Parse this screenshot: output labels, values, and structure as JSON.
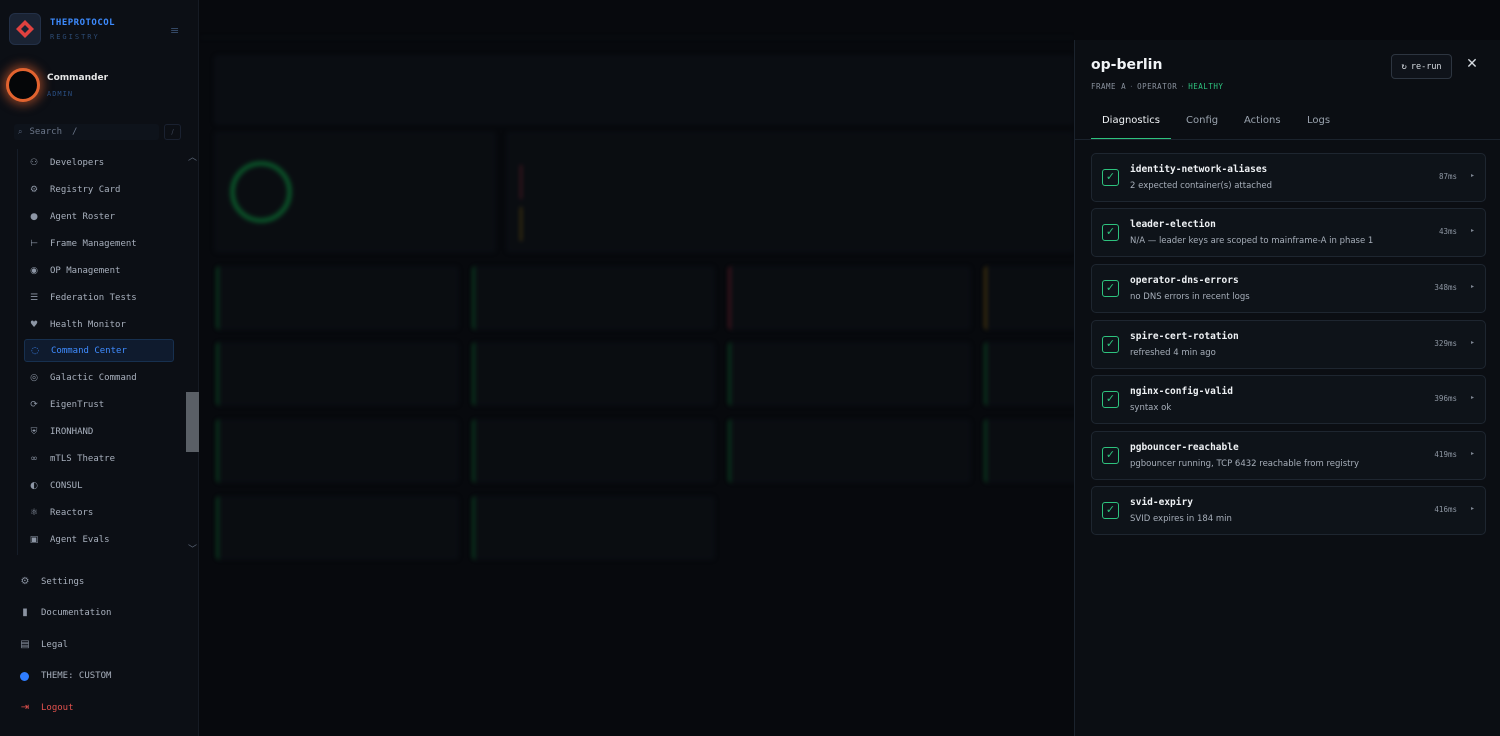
{
  "brand": {
    "name": "THEPROTOCOL",
    "subtitle": "REGISTRY"
  },
  "user": {
    "name": "Commander",
    "role": "ADMIN"
  },
  "search": {
    "label": "Search",
    "shortcut": "/"
  },
  "nav": {
    "items": [
      {
        "label": "Developers",
        "icon": "users-icon"
      },
      {
        "label": "Registry Card",
        "icon": "card-icon"
      },
      {
        "label": "Agent Roster",
        "icon": "person-icon"
      },
      {
        "label": "Frame Management",
        "icon": "frame-icon"
      },
      {
        "label": "OP Management",
        "icon": "op-icon"
      },
      {
        "label": "Federation Tests",
        "icon": "server-icon"
      },
      {
        "label": "Health Monitor",
        "icon": "heart-pulse-icon"
      },
      {
        "label": "Command Center",
        "icon": "radar-icon",
        "active": true
      },
      {
        "label": "Galactic Command",
        "icon": "target-icon"
      },
      {
        "label": "EigenTrust",
        "icon": "trust-icon"
      },
      {
        "label": "IRONHAND",
        "icon": "shield-icon"
      },
      {
        "label": "mTLS Theatre",
        "icon": "link-icon"
      },
      {
        "label": "CONSUL",
        "icon": "consul-icon"
      },
      {
        "label": "Reactors",
        "icon": "atom-icon"
      },
      {
        "label": "Agent Evals",
        "icon": "clipboard-icon"
      }
    ]
  },
  "bottom": {
    "settings": "Settings",
    "documentation": "Documentation",
    "legal": "Legal",
    "theme": "THEME: CUSTOM",
    "logout": "Logout"
  },
  "colors": {
    "accent": "#3f8cff",
    "healthy": "#2ec27e",
    "danger": "#e0514d",
    "avatar_ring": "#e2632f"
  },
  "panel": {
    "title": "op-berlin",
    "meta": {
      "frame": "FRAME A",
      "kind": "OPERATOR",
      "status": "HEALTHY"
    },
    "rerun_label": "re-run",
    "tabs": [
      "Diagnostics",
      "Config",
      "Actions",
      "Logs"
    ],
    "active_tab": "Diagnostics",
    "checks": [
      {
        "name": "identity-network-aliases",
        "desc": "2 expected container(s) attached",
        "time": "87ms",
        "passed": true
      },
      {
        "name": "leader-election",
        "desc": "N/A — leader keys are scoped to mainframe-A in phase 1",
        "time": "43ms",
        "passed": true
      },
      {
        "name": "operator-dns-errors",
        "desc": "no DNS errors in recent logs",
        "time": "348ms",
        "passed": true
      },
      {
        "name": "spire-cert-rotation",
        "desc": "refreshed 4 min ago",
        "time": "329ms",
        "passed": true
      },
      {
        "name": "nginx-config-valid",
        "desc": "syntax ok",
        "time": "396ms",
        "passed": true
      },
      {
        "name": "pgbouncer-reachable",
        "desc": "pgbouncer running, TCP 6432 reachable from registry",
        "time": "419ms",
        "passed": true
      },
      {
        "name": "svid-expiry",
        "desc": "SVID expires in 184 min",
        "time": "416ms",
        "passed": true
      }
    ]
  }
}
